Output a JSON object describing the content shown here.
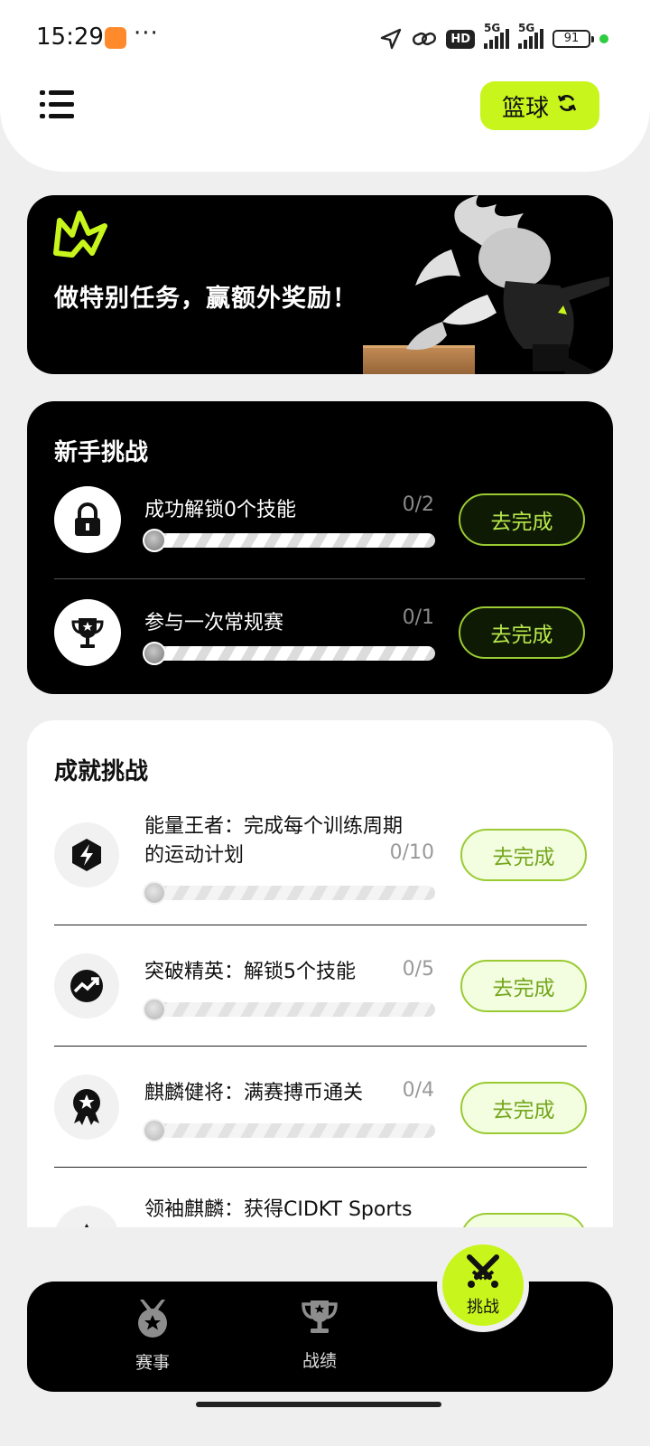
{
  "status_bar": {
    "time": "15:29",
    "more": "···",
    "network_hd": "HD",
    "network_5g_1": "5G",
    "network_5g_2": "5G",
    "battery": "91"
  },
  "header": {
    "sport_label": "篮球"
  },
  "banner": {
    "text": "做特别任务，赢额外奖励！"
  },
  "newbie": {
    "title": "新手挑战",
    "items": [
      {
        "label": "成功解锁0个技能",
        "count": "0/2",
        "progress": 0,
        "button": "去完成",
        "icon": "lock-icon"
      },
      {
        "label": "参与一次常规赛",
        "count": "0/1",
        "progress": 0,
        "button": "去完成",
        "icon": "trophy-icon"
      }
    ]
  },
  "achievements": {
    "title": "成就挑战",
    "items": [
      {
        "label_line1": "能量王者：完成每个训练周期",
        "label_line2": "的运动计划",
        "count": "0/10",
        "progress": 0,
        "button": "去完成",
        "icon": "energy-icon"
      },
      {
        "label": "突破精英：解锁5个技能",
        "count": "0/5",
        "progress": 0,
        "button": "去完成",
        "icon": "trend-chart-icon"
      },
      {
        "label": "麒麟健将：满赛搏币通关",
        "count": "0/4",
        "progress": 0,
        "button": "去完成",
        "icon": "medal-star-icon"
      },
      {
        "label": "领袖麒麟：获得CIDKT Sports",
        "icon": "triangle-icon"
      }
    ]
  },
  "nav": {
    "items": [
      {
        "label": "赛事",
        "icon": "medal-icon"
      },
      {
        "label": "战绩",
        "icon": "trophy-icon"
      }
    ],
    "active": {
      "label": "挑战",
      "icon": "crossed-swords-icon"
    }
  },
  "colors": {
    "accent": "#c8f51c",
    "dark": "#000000",
    "button_border": "#9acb32"
  }
}
